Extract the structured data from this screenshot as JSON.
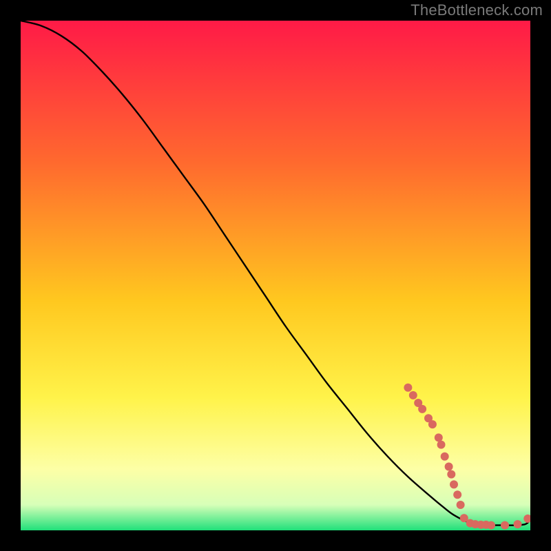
{
  "watermark": {
    "text": "TheBottleneck.com"
  },
  "gradient_colors": {
    "top": "#ff1a47",
    "mid1": "#ff6a2e",
    "mid2": "#ffc81f",
    "mid3": "#fff34a",
    "low1": "#fdffa6",
    "low2": "#d7ffb8",
    "bottom": "#20e07a"
  },
  "chart_data": {
    "type": "line",
    "title": "",
    "xlabel": "",
    "ylabel": "",
    "xlim": [
      0,
      100
    ],
    "ylim": [
      0,
      100
    ],
    "series": [
      {
        "name": "curve",
        "x": [
          0,
          4,
          8,
          12,
          16,
          20,
          24,
          28,
          32,
          36,
          40,
          44,
          48,
          52,
          56,
          60,
          64,
          68,
          72,
          76,
          80,
          83,
          85,
          88,
          90,
          92,
          95,
          97,
          99,
          100
        ],
        "values": [
          100,
          99,
          97,
          94,
          90,
          85.5,
          80.5,
          75,
          69.5,
          64,
          58,
          52,
          46,
          40,
          34.5,
          29,
          24,
          19,
          14.5,
          10.5,
          7,
          4.5,
          3,
          1.5,
          1,
          1,
          1,
          1,
          1.2,
          2
        ]
      }
    ],
    "markers": [
      {
        "series": "curve",
        "x": 76.0,
        "y": 28.0
      },
      {
        "series": "curve",
        "x": 77.0,
        "y": 26.5
      },
      {
        "series": "curve",
        "x": 78.0,
        "y": 25.0
      },
      {
        "series": "curve",
        "x": 78.8,
        "y": 23.8
      },
      {
        "series": "curve",
        "x": 80.0,
        "y": 22.0
      },
      {
        "series": "curve",
        "x": 80.8,
        "y": 20.8
      },
      {
        "series": "curve",
        "x": 82.0,
        "y": 18.2
      },
      {
        "series": "curve",
        "x": 82.5,
        "y": 16.8
      },
      {
        "series": "curve",
        "x": 83.2,
        "y": 14.5
      },
      {
        "series": "curve",
        "x": 84.0,
        "y": 12.5
      },
      {
        "series": "curve",
        "x": 84.5,
        "y": 11.0
      },
      {
        "series": "curve",
        "x": 85.0,
        "y": 9.0
      },
      {
        "series": "curve",
        "x": 85.7,
        "y": 7.0
      },
      {
        "series": "curve",
        "x": 86.3,
        "y": 5.0
      },
      {
        "series": "curve",
        "x": 87.0,
        "y": 2.4
      },
      {
        "series": "curve",
        "x": 88.2,
        "y": 1.4
      },
      {
        "series": "curve",
        "x": 89.2,
        "y": 1.2
      },
      {
        "series": "curve",
        "x": 90.3,
        "y": 1.1
      },
      {
        "series": "curve",
        "x": 91.3,
        "y": 1.1
      },
      {
        "series": "curve",
        "x": 92.3,
        "y": 1.0
      },
      {
        "series": "curve",
        "x": 95.0,
        "y": 1.0
      },
      {
        "series": "curve",
        "x": 97.5,
        "y": 1.2
      },
      {
        "series": "curve",
        "x": 99.5,
        "y": 2.3
      }
    ],
    "marker_style": {
      "color": "#d9695f",
      "radius_px": 6
    }
  }
}
